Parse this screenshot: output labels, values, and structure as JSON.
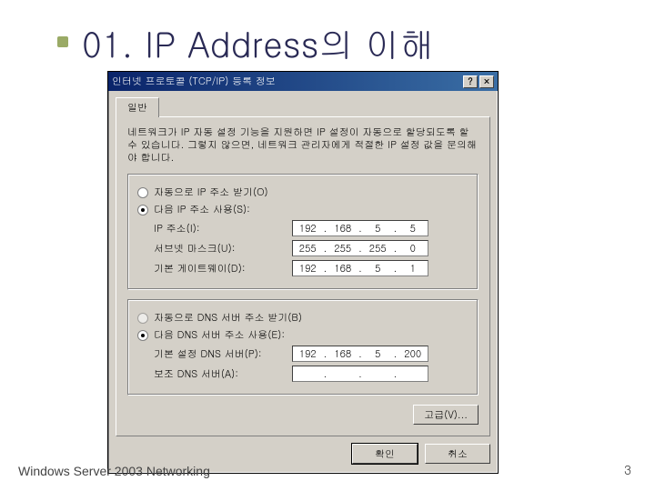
{
  "slide": {
    "title": "01. IP Address의 이해",
    "footer": "Windows Server 2003 Networking",
    "page": "3"
  },
  "dialog": {
    "title": "인터넷 프로토콜 (TCP/IP) 등록 정보",
    "help_btn": "?",
    "close_btn": "×",
    "tab": "일반",
    "description": "네트워크가 IP 자동 설정 기능을 지원하면 IP 설정이 자동으로 할당되도록 할 수 있습니다. 그렇지 않으면, 네트워크 관리자에게 적절한 IP 설정 값을 문의해야 합니다.",
    "ip_group": {
      "radio_auto": "자동으로 IP 주소 받기(O)",
      "radio_manual": "다음 IP 주소 사용(S):",
      "ip_label": "IP 주소(I):",
      "ip_value": [
        "192",
        "168",
        "5",
        "5"
      ],
      "mask_label": "서브넷 마스크(U):",
      "mask_value": [
        "255",
        "255",
        "255",
        "0"
      ],
      "gw_label": "기본 게이트웨이(D):",
      "gw_value": [
        "192",
        "168",
        "5",
        "1"
      ]
    },
    "dns_group": {
      "radio_auto": "자동으로 DNS 서버 주소 받기(B)",
      "radio_manual": "다음 DNS 서버 주소 사용(E):",
      "pref_label": "기본 설정 DNS 서버(P):",
      "pref_value": [
        "192",
        "168",
        "5",
        "200"
      ],
      "alt_label": "보조 DNS 서버(A):",
      "alt_value": [
        "",
        "",
        "",
        ""
      ]
    },
    "advanced": "고급(V)...",
    "ok": "확인",
    "cancel": "취소"
  }
}
